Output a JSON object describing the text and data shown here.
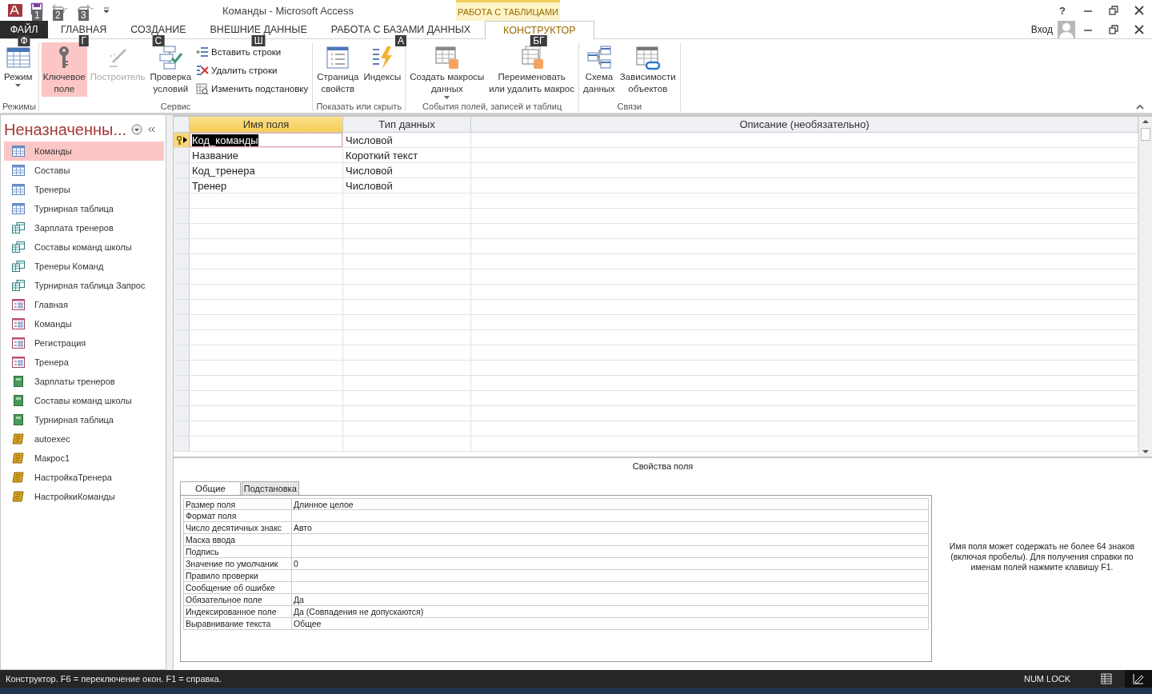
{
  "window": {
    "title": "Команды - Microsoft Access",
    "context_group": "РАБОТА С ТАБЛИЦАМИ",
    "help": "?",
    "sign_in": "Вход"
  },
  "quick_access": [
    {
      "kind": "save",
      "keytip": "1"
    },
    {
      "kind": "undo",
      "keytip": "2"
    },
    {
      "kind": "redo",
      "keytip": "3"
    }
  ],
  "tabs": [
    {
      "label": "ФАЙЛ",
      "kind": "file",
      "keytip": "Ф",
      "selected": false
    },
    {
      "label": "ГЛАВНАЯ",
      "kind": "main",
      "keytip": "Г",
      "selected": false
    },
    {
      "label": "СОЗДАНИЕ",
      "kind": "main",
      "keytip": "С",
      "selected": false
    },
    {
      "label": "ВНЕШНИЕ ДАННЫЕ",
      "kind": "main",
      "keytip": "Ш",
      "selected": false
    },
    {
      "label": "РАБОТА С БАЗАМИ ДАННЫХ",
      "kind": "main",
      "keytip": "А",
      "selected": false
    },
    {
      "label": "КОНСТРУКТОР",
      "kind": "context",
      "keytip": "БГ",
      "selected": true
    }
  ],
  "ribbon": {
    "groups": [
      {
        "label": "Режимы",
        "items": [
          {
            "kind": "large",
            "label": "Режим",
            "menu": true,
            "on": false,
            "disabled": false
          }
        ]
      },
      {
        "label": "Сервис",
        "items": [
          {
            "kind": "large",
            "label": "Ключевое\nполе",
            "menu": false,
            "on": true,
            "disabled": false
          },
          {
            "kind": "large",
            "label": "Построитель",
            "menu": false,
            "on": false,
            "disabled": true
          },
          {
            "kind": "large",
            "label": "Проверка\nусловий",
            "menu": false,
            "on": false,
            "disabled": false
          },
          {
            "kind": "small",
            "label": "Вставить строки",
            "on": false,
            "disabled": false
          },
          {
            "kind": "small",
            "label": "Удалить строки",
            "on": false,
            "disabled": false
          },
          {
            "kind": "small",
            "label": "Изменить подстановку",
            "on": false,
            "disabled": false
          }
        ]
      },
      {
        "label": "Показать или скрыть",
        "items": [
          {
            "kind": "large",
            "label": "Страница\nсвойств",
            "menu": false,
            "on": false,
            "disabled": false
          },
          {
            "kind": "large",
            "label": "Индексы",
            "menu": false,
            "on": false,
            "disabled": false
          }
        ]
      },
      {
        "label": "События полей, записей и таблиц",
        "items": [
          {
            "kind": "large",
            "label": "Создать макросы\nданных",
            "menu": true,
            "on": false,
            "disabled": false
          },
          {
            "kind": "large",
            "label": "Переименовать\nили удалить макрос",
            "menu": false,
            "on": false,
            "disabled": false
          }
        ]
      },
      {
        "label": "Связи",
        "items": [
          {
            "kind": "large",
            "label": "Схема\nданных",
            "menu": false,
            "on": false,
            "disabled": false
          },
          {
            "kind": "large",
            "label": "Зависимости\nобъектов",
            "menu": false,
            "on": false,
            "disabled": false
          }
        ]
      }
    ]
  },
  "nav": {
    "title": "Неназначенны...",
    "items": [
      {
        "label": "Команды",
        "kind": "table",
        "selected": true
      },
      {
        "label": "Составы",
        "kind": "table",
        "selected": false
      },
      {
        "label": "Тренеры",
        "kind": "table",
        "selected": false
      },
      {
        "label": "Турнирная таблица",
        "kind": "table",
        "selected": false
      },
      {
        "label": "Зарплата тренеров",
        "kind": "query",
        "selected": false
      },
      {
        "label": "Составы команд школы",
        "kind": "query",
        "selected": false
      },
      {
        "label": "Тренеры Команд",
        "kind": "query",
        "selected": false
      },
      {
        "label": "Турнирная таблица Запрос",
        "kind": "query",
        "selected": false
      },
      {
        "label": "Главная",
        "kind": "form",
        "selected": false
      },
      {
        "label": "Команды",
        "kind": "form",
        "selected": false
      },
      {
        "label": "Регистрация",
        "kind": "form",
        "selected": false
      },
      {
        "label": "Тренера",
        "kind": "form",
        "selected": false
      },
      {
        "label": "Зарплаты тренеров",
        "kind": "report",
        "selected": false
      },
      {
        "label": "Составы команд школы",
        "kind": "report",
        "selected": false
      },
      {
        "label": "Турнирная таблица",
        "kind": "report",
        "selected": false
      },
      {
        "label": "autoexec",
        "kind": "macro",
        "selected": false
      },
      {
        "label": "Макрос1",
        "kind": "macro",
        "selected": false
      },
      {
        "label": "НастройкаТренера",
        "kind": "macro",
        "selected": false
      },
      {
        "label": "НастройкиКоманды",
        "kind": "macro",
        "selected": false
      }
    ]
  },
  "design": {
    "columns": [
      "Имя поля",
      "Тип данных",
      "Описание (необязательно)"
    ],
    "rows": [
      {
        "name": "Код_команды",
        "type": "Числовой",
        "primary_key": true,
        "current": true
      },
      {
        "name": "Название",
        "type": "Короткий текст",
        "primary_key": false,
        "current": false
      },
      {
        "name": "Код_тренера",
        "type": "Числовой",
        "primary_key": false,
        "current": false
      },
      {
        "name": "Тренер",
        "type": "Числовой",
        "primary_key": false,
        "current": false
      }
    ]
  },
  "properties": {
    "caption": "Свойства поля",
    "tabs": [
      {
        "label": "Общие",
        "selected": true
      },
      {
        "label": "Подстановка",
        "selected": false
      }
    ],
    "rows": [
      {
        "label": "Размер поля",
        "value": "Длинное целое"
      },
      {
        "label": "Формат поля"
      },
      {
        "label": "Число десятичных знакс",
        "value": "Авто"
      },
      {
        "label": "Маска ввода"
      },
      {
        "label": "Подпись"
      },
      {
        "label": "Значение по умолчаник",
        "value": "0"
      },
      {
        "label": "Правило проверки"
      },
      {
        "label": "Сообщение об ошибке"
      },
      {
        "label": "Обязательное поле",
        "value": "Да"
      },
      {
        "label": "Индексированное поле",
        "value": "Да (Совпадения не допускаются)"
      },
      {
        "label": "Выравнивание текста",
        "value": "Общее"
      }
    ],
    "help": "Имя поля может содержать не более 64 знаков (включая пробелы). Для получения справки по именам полей нажмите клавишу F1."
  },
  "status_bar": {
    "text": "Конструктор.  F6 = переключение окон.  F1 = справка.",
    "indicator": "NUM LOCK"
  }
}
